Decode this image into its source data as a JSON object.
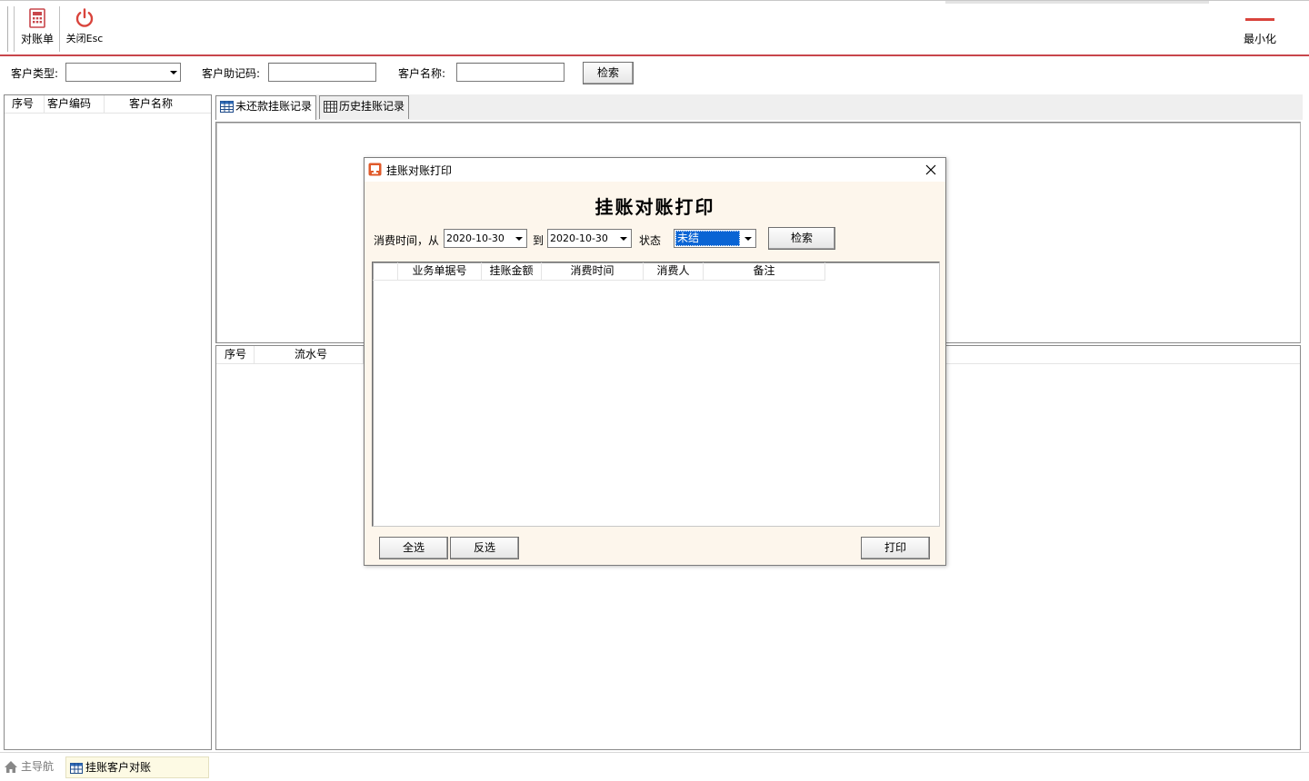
{
  "toolbar": {
    "reconcile_label": "对账单",
    "close_label": "关闭Esc",
    "minimize_label": "最小化"
  },
  "filters": {
    "customer_type_label": "客户类型:",
    "customer_type_value": "",
    "mnemonic_label": "客户助记码:",
    "mnemonic_value": "",
    "customer_name_label": "客户名称:",
    "customer_name_value": "",
    "search_label": "检索"
  },
  "customer_list": {
    "columns": [
      "序号",
      "客户编码",
      "客户名称"
    ]
  },
  "tabs": [
    {
      "label": "未还款挂账记录",
      "active": true
    },
    {
      "label": "历史挂账记录",
      "active": false
    }
  ],
  "detail_grid": {
    "columns": [
      "序号",
      "流水号"
    ]
  },
  "statusbar": {
    "home_label": "主导航",
    "current_label": "挂账客户对账"
  },
  "dialog": {
    "title": "挂账对账打印",
    "heading": "挂账对账打印",
    "from_label": "消费时间，从",
    "from_date": "2020-10-30",
    "to_label": "到",
    "to_date": "2020-10-30",
    "state_label": "状态",
    "state_value": "未结",
    "search_label": "检索",
    "columns": [
      "",
      "业务单据号",
      "挂账金额",
      "消费时间",
      "消费人",
      "备注"
    ],
    "select_all_label": "全选",
    "invert_label": "反选",
    "print_label": "打印"
  },
  "colors": {
    "accent_line": "#c8464b",
    "dialog_bg": "#fdf6ec",
    "selection": "#0a64d4"
  }
}
